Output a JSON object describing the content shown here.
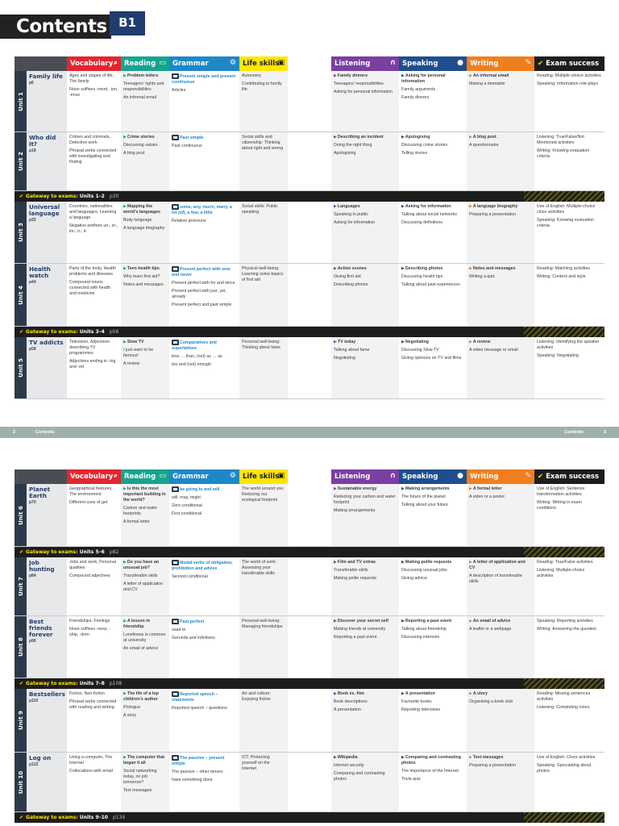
{
  "page": {
    "title": "Contents",
    "level": "B1",
    "footer_left_num": "2",
    "footer_left_label": "Contents",
    "footer_right_label": "Contents",
    "footer_right_num": "3"
  },
  "headers": {
    "vocabulary": "Vocabulary",
    "reading": "Reading",
    "grammar": "Grammar",
    "life_skills": "Life skills",
    "listening": "Listening",
    "speaking": "Speaking",
    "writing": "Writing",
    "exam": "Exam success"
  },
  "colors": {
    "vocabulary": "#e3262f",
    "reading": "#17a38f",
    "grammar": "#1e88c7",
    "life_skills": "#ffe600",
    "listening": "#7b3fa0",
    "speaking": "#1e4f8c",
    "writing": "#f07e1f",
    "exam": "#1d1d1d"
  },
  "units": [
    {
      "unit": "Unit 1",
      "name": "Family life",
      "page": "p6",
      "vocab": [
        "Ages and stages of life, The family",
        "Noun suffixes -ment, -ion, -ence"
      ],
      "reading_title": "Problem letters",
      "reading": [
        "Teenagers' rights and responsibilities",
        "An informal email"
      ],
      "grammar_title": "Present simple and present continuous",
      "grammar": [
        "Articles"
      ],
      "life": [
        "Autonomy",
        "Contributing to family life"
      ],
      "listening_title": "Family dinners",
      "listening": [
        "Teenagers' responsibilities",
        "Asking for personal information"
      ],
      "speaking_title": "Asking for personal information",
      "speaking": [
        "Family arguments",
        "Family dinners"
      ],
      "writing_title": "An informal email",
      "writing": [
        "Making a timetable"
      ],
      "exam": [
        "Reading: Multiple-choice activities",
        "Speaking: Information role-plays"
      ]
    },
    {
      "unit": "Unit 2",
      "name": "Who did it?",
      "page": "p18",
      "vocab": [
        "Crimes and criminals, Detective work",
        "Phrasal verbs connected with investigating and finding"
      ],
      "reading_title": "Crime stories",
      "reading": [
        "Discussing values",
        "A blog post"
      ],
      "grammar_title": "Past simple",
      "grammar": [
        "Past continuous"
      ],
      "life": [
        "Social skills and citizenship: Thinking about right and wrong"
      ],
      "listening_title": "Describing an incident",
      "listening": [
        "Doing the right thing",
        "Apologising"
      ],
      "speaking_title": "Apologising",
      "speaking": [
        "Discussing crime stories",
        "Telling stories"
      ],
      "writing_title": "A blog post",
      "writing": [
        "A questionnaire"
      ],
      "exam": [
        "Listening: True/False/Not Mentioned activities",
        "Writing: Knowing evaluation criteria"
      ]
    },
    {
      "unit": "Unit 3",
      "name": "Universal language",
      "page": "p32",
      "vocab": [
        "Countries, nationalities and languages, Learning a language",
        "Negative prefixes un-, in-, im-, ir-, il-"
      ],
      "reading_title": "Mapping the world's languages",
      "reading": [
        "Body language",
        "A language biography"
      ],
      "grammar_title": "some, any, much, many, a lot (of), a few, a little",
      "grammar": [
        "Relative pronouns"
      ],
      "life": [
        "Social skills: Public speaking"
      ],
      "listening_title": "Languages",
      "listening": [
        "Speaking in public",
        "Asking for information"
      ],
      "speaking_title": "Asking for information",
      "speaking": [
        "Talking about social networks",
        "Discussing definitions"
      ],
      "writing_title": "A language biography",
      "writing": [
        "Preparing a presentation"
      ],
      "exam": [
        "Use of English: Multiple-choice cloze activities",
        "Speaking: Knowing evaluation criteria"
      ]
    },
    {
      "unit": "Unit 4",
      "name": "Health watch",
      "page": "p44",
      "vocab": [
        "Parts of the body, Health problems and illnesses",
        "Compound nouns connected with health and medicine"
      ],
      "reading_title": "Teen health tips",
      "reading": [
        "Why learn first aid?",
        "Notes and messages"
      ],
      "grammar_title": "Present perfect with ever and never",
      "grammar": [
        "Present perfect with for and since",
        "Present perfect with just, yet, already",
        "Present perfect and past simple"
      ],
      "life": [
        "Physical well-being: Learning some basics of first aid"
      ],
      "listening_title": "Action scenes",
      "listening": [
        "Giving first aid",
        "Describing photos"
      ],
      "speaking_title": "Describing photos",
      "speaking": [
        "Discussing health tips",
        "Talking about past experiences"
      ],
      "writing_title": "Notes and messages",
      "writing": [
        "Writing a quiz"
      ],
      "exam": [
        "Reading: Matching activities",
        "Writing: Content and style"
      ]
    },
    {
      "unit": "Unit 5",
      "name": "TV addicts",
      "page": "p58",
      "vocab": [
        "Television, Adjectives describing TV programmes",
        "Adjectives ending in -ing and -ed"
      ],
      "reading_title": "Slow TV",
      "reading": [
        "I just want to be famous!",
        "A review"
      ],
      "grammar_title": "Comparatives and superlatives",
      "grammar": [
        "less … than, (not) as … as",
        "too and (not) enough"
      ],
      "life": [
        "Personal well-being: Thinking about fame"
      ],
      "listening_title": "TV today",
      "listening": [
        "Talking about fame",
        "Negotiating"
      ],
      "speaking_title": "Negotiating",
      "speaking": [
        "Discussing Slow TV",
        "Giving opinions on TV and films"
      ],
      "writing_title": "A review",
      "writing": [
        "A video message or email"
      ],
      "exam": [
        "Listening: Identifying the speaker activities",
        "Speaking: Negotiating"
      ]
    },
    {
      "unit": "Unit 6",
      "name": "Planet Earth",
      "page": "p70",
      "vocab": [
        "Geographical features, The environment",
        "Different uses of get"
      ],
      "reading_title": "Is this the most important building in the world?",
      "reading": [
        "Carbon and water footprints",
        "A formal letter"
      ],
      "grammar_title": "be going to and will",
      "grammar": [
        "will, may, might",
        "Zero conditional",
        "First conditional"
      ],
      "life": [
        "The world around you: Reducing our ecological footprint"
      ],
      "listening_title": "Sustainable energy",
      "listening": [
        "Reducing your carbon and water footprint",
        "Making arrangements"
      ],
      "speaking_title": "Making arrangements",
      "speaking": [
        "The future of the planet",
        "Talking about your future"
      ],
      "writing_title": "A formal letter",
      "writing": [
        "A video or a poster"
      ],
      "exam": [
        "Use of English: Sentence transformation activities",
        "Writing: Writing in exam conditions"
      ]
    },
    {
      "unit": "Unit 7",
      "name": "Job hunting",
      "page": "p84",
      "vocab": [
        "Jobs and work, Personal qualities",
        "Compound adjectives"
      ],
      "reading_title": "Do you have an unusual job?",
      "reading": [
        "Transferable skills",
        "A letter of application and CV"
      ],
      "grammar_title": "Modal verbs of obligation, prohibition and advice",
      "grammar": [
        "Second conditional"
      ],
      "life": [
        "The world of work: Assessing your transferable skills"
      ],
      "listening_title": "Film and TV extras",
      "listening": [
        "Transferable skills",
        "Making polite requests"
      ],
      "speaking_title": "Making polite requests",
      "speaking": [
        "Discussing unusual jobs",
        "Giving advice"
      ],
      "writing_title": "A letter of application and CV",
      "writing": [
        "A description of transferable skills"
      ],
      "exam": [
        "Reading: True/False activities",
        "Listening: Multiple-choice activities"
      ]
    },
    {
      "unit": "Unit 8",
      "name": "Best friends forever",
      "page": "p96",
      "vocab": [
        "Friendships, Feelings",
        "Noun suffixes -ness, -ship, -dom"
      ],
      "reading_title": "A lesson in friendship",
      "reading": [
        "Loneliness is common at university",
        "An email of advice"
      ],
      "grammar_title": "Past perfect",
      "grammar": [
        "used to",
        "Gerunds and infinitives"
      ],
      "life": [
        "Personal well-being: Managing friendships"
      ],
      "listening_title": "Discover your secret self",
      "listening": [
        "Making friends at university",
        "Reporting a past event"
      ],
      "speaking_title": "Reporting a past event",
      "speaking": [
        "Talking about friendship",
        "Discussing interests"
      ],
      "writing_title": "An email of advice",
      "writing": [
        "A leaflet or a webpage"
      ],
      "exam": [
        "Speaking: Reporting activities",
        "Writing: Answering the question"
      ]
    },
    {
      "unit": "Unit 9",
      "name": "Bestsellers",
      "page": "p110",
      "vocab": [
        "Fiction, Non-fiction",
        "Phrasal verbs connected with reading and writing"
      ],
      "reading_title": "The life of a top children's author",
      "reading": [
        "Prologue",
        "A story"
      ],
      "grammar_title": "Reported speech – statements",
      "grammar": [
        "Reported speech – questions"
      ],
      "life": [
        "Art and culture: Enjoying fiction"
      ],
      "listening_title": "Book vs. film",
      "listening": [
        "Book descriptions",
        "A presentation"
      ],
      "speaking_title": "A presentation",
      "speaking": [
        "Favourite books",
        "Reporting interviews"
      ],
      "writing_title": "A story",
      "writing": [
        "Organising a book club"
      ],
      "exam": [
        "Reading: Missing sentences activities",
        "Listening: Completing notes"
      ]
    },
    {
      "unit": "Unit 10",
      "name": "Log on",
      "page": "p122",
      "vocab": [
        "Using a computer, The Internet",
        "Collocations with email"
      ],
      "reading_title": "The computer that began it all",
      "reading": [
        "Social networking today, no job tomorrow?",
        "Text messages"
      ],
      "grammar_title": "The passive – present simple",
      "grammar": [
        "The passive – other tenses",
        "have something done"
      ],
      "life": [
        "ICT: Protecting yourself on the Internet"
      ],
      "listening_title": "Wikipedia",
      "listening": [
        "Internet security",
        "Comparing and contrasting photos"
      ],
      "speaking_title": "Comparing and contrasting photos",
      "speaking": [
        "The importance of the Internet",
        "Trivia quiz"
      ],
      "writing_title": "Text messages",
      "writing": [
        "Preparing a presentation"
      ],
      "exam": [
        "Use of English: Cloze activities",
        "Speaking: Speculating about photos"
      ]
    }
  ],
  "gateways": [
    {
      "label": "Gateway to exams:",
      "units": "Units 1–2",
      "page": "p30"
    },
    {
      "label": "Gateway to exams:",
      "units": "Units 3–4",
      "page": "p56"
    },
    {
      "label": "Gateway to exams:",
      "units": "Units 5–6",
      "page": "p82"
    },
    {
      "label": "Gateway to exams:",
      "units": "Units 7–8",
      "page": "p108"
    },
    {
      "label": "Gateway to exams:",
      "units": "Units 9–10",
      "page": "p134"
    }
  ]
}
